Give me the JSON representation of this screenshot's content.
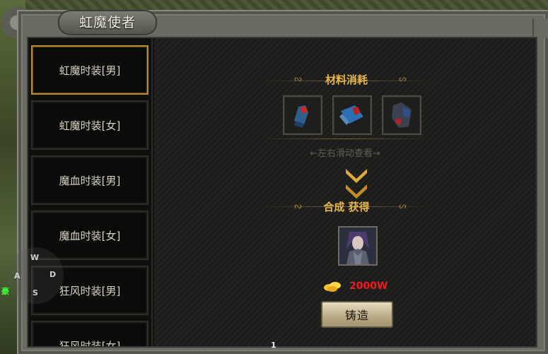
{
  "window": {
    "title": "虹魔使者"
  },
  "list": [
    {
      "label": "虹魔时装[男]",
      "selected": true
    },
    {
      "label": "虹魔时装[女]",
      "selected": false
    },
    {
      "label": "魔血时装[男]",
      "selected": false
    },
    {
      "label": "魔血时装[女]",
      "selected": false
    },
    {
      "label": "狂风时装[男]",
      "selected": false
    },
    {
      "label": "狂风时装[女]",
      "selected": false
    }
  ],
  "materials": {
    "title": "材料消耗",
    "hint": "←左右滑动查看→",
    "items": [
      "material-slot-1",
      "material-slot-2",
      "material-slot-3"
    ]
  },
  "result": {
    "title": "合成 获得",
    "cost": "2000W"
  },
  "actions": {
    "forge_label": "铸造"
  },
  "overlay": {
    "joystick": [
      "W",
      "A",
      "S",
      "D"
    ],
    "page": "1",
    "tag": "豪"
  },
  "colors": {
    "accent": "#e7b64e",
    "cost": "#ee1d1d",
    "selected_border": "#b8892e"
  }
}
